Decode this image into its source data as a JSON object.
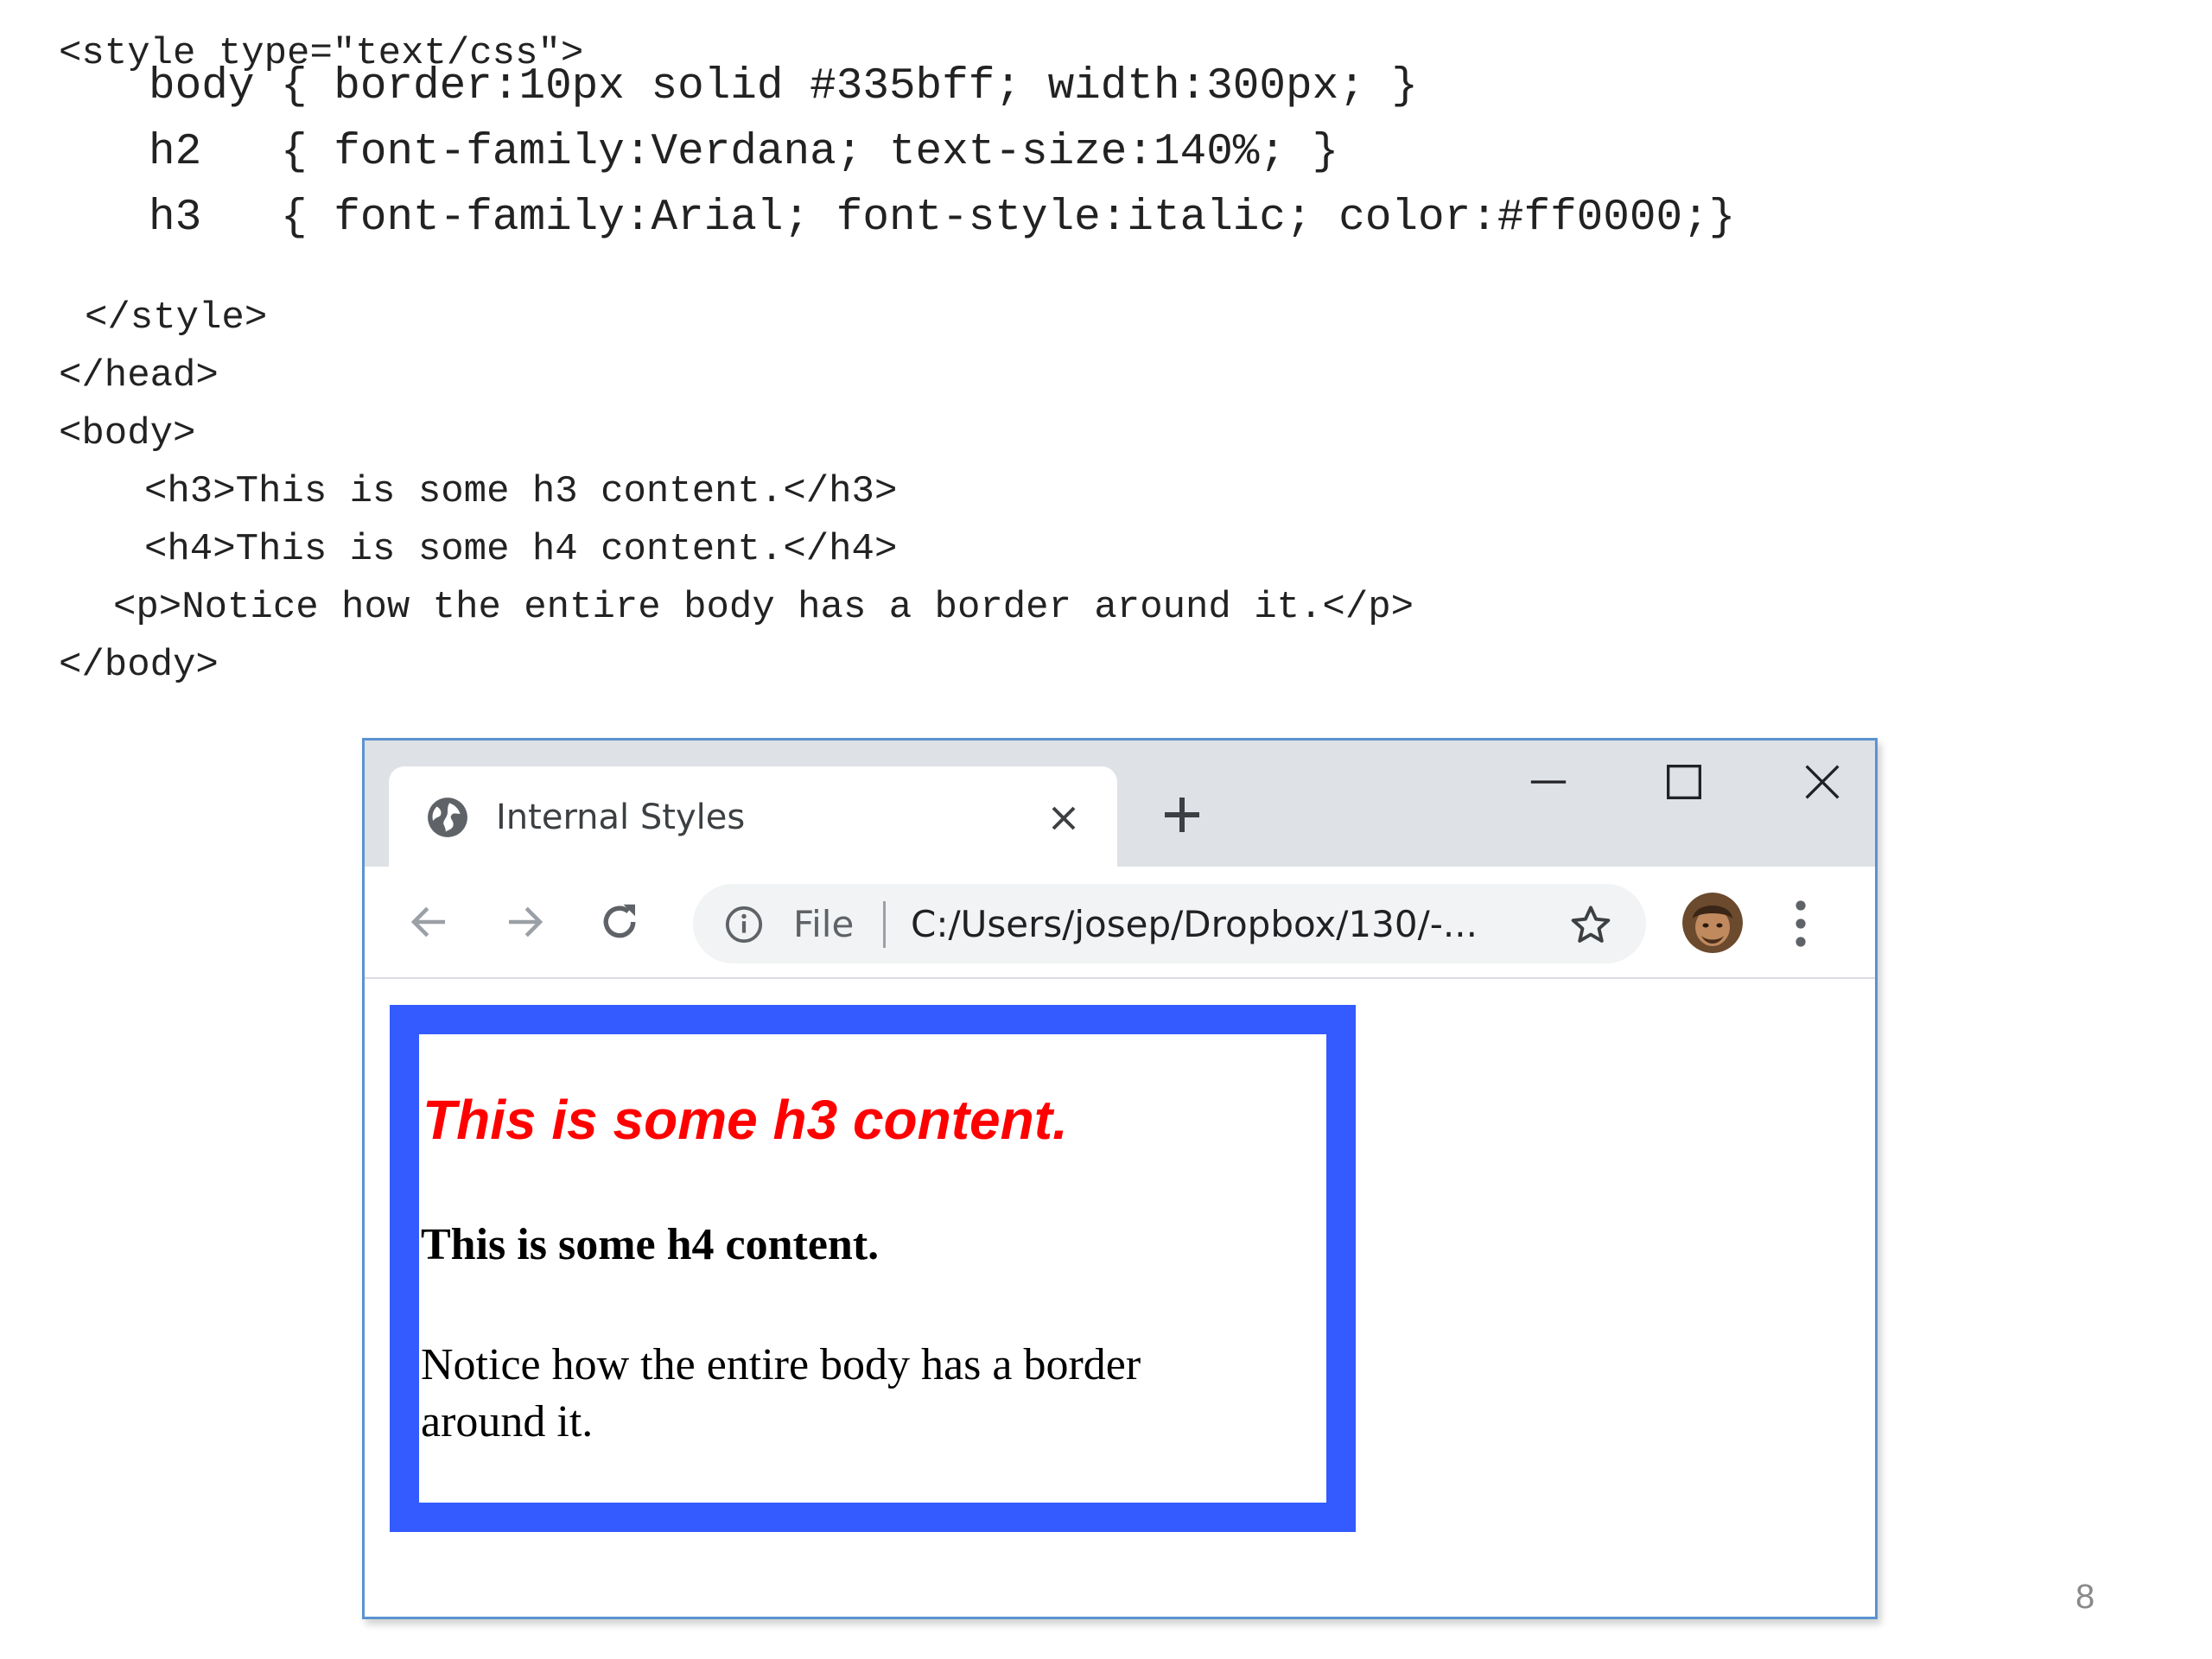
{
  "code_lines": [
    "<style type=\"text/css\">",
    "body { border:10px solid #335bff; width:300px; }",
    "h2   { font-family:Verdana; text-size:140%; }",
    "h3   { font-family:Arial; font-style:italic; color:#ff0000;}",
    "</style>",
    "</head>",
    "<body>",
    "<h3>This is some h3 content.</h3>",
    "<h4>This is some h4 content.</h4>",
    "<p>Notice how the entire body has a border around it.</p>",
    "</body>"
  ],
  "browser": {
    "tab": {
      "title": "Internal Styles",
      "icon": "globe-icon",
      "close_icon": "close-icon"
    },
    "new_tab_icon": "plus-icon",
    "window_controls": [
      "minimize-icon",
      "maximize-icon",
      "close-icon"
    ],
    "toolbar": {
      "nav_icons": [
        "back-arrow-icon",
        "forward-arrow-icon",
        "reload-icon"
      ],
      "info_icon": "info-icon",
      "scheme_label": "File",
      "url": "C:/Users/josep/Dropbox/130/-...",
      "bookmark_icon": "star-icon",
      "avatar": "profile-avatar",
      "menu_icon": "kebab-menu-icon"
    },
    "page": {
      "border_color": "#335bff",
      "h3_text": "This is some h3 content.",
      "h3_color": "#ff0000",
      "h4_text": "This is some h4 content.",
      "p_text": "Notice how the entire body has a border around it."
    }
  },
  "slide_number": "8"
}
